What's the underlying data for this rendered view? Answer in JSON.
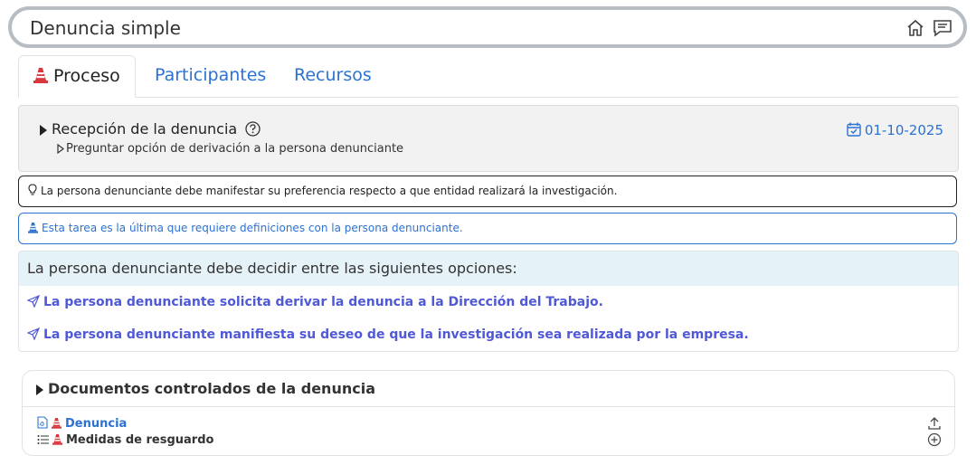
{
  "header": {
    "title": "Denuncia simple",
    "icons": [
      "home-icon",
      "chat-icon"
    ]
  },
  "tabs": [
    {
      "label": "Proceso",
      "active": true
    },
    {
      "label": "Participantes",
      "active": false
    },
    {
      "label": "Recursos",
      "active": false
    }
  ],
  "step": {
    "title": "Recepción de la denuncia",
    "subtitle": "Preguntar opción de derivación a la persona denunciante",
    "date": "01-10-2025"
  },
  "notes": {
    "hint": "La persona denunciante debe manifestar su preferencia respecto a que entidad realizará la investigación.",
    "info": "Esta tarea es la última que requiere definiciones con la persona denunciante."
  },
  "decision": {
    "heading": "La persona denunciante debe decidir entre las siguientes opciones:",
    "options": [
      "La persona denunciante solicita derivar la denuncia a la Dirección del Trabajo.",
      "La persona denunciante manifiesta su deseo de que la investigación sea realizada por la empresa."
    ]
  },
  "documents": {
    "heading": "Documentos controlados de la denuncia",
    "items": [
      {
        "label": "Denuncia",
        "action_icon": "upload-icon"
      },
      {
        "label": "Medidas de resguardo",
        "action_icon": "add-circle-icon"
      }
    ]
  },
  "colors": {
    "accent": "#2b72d2",
    "option": "#4f58d6",
    "cone": "#d9363e",
    "frame": "#b7bdc3"
  }
}
